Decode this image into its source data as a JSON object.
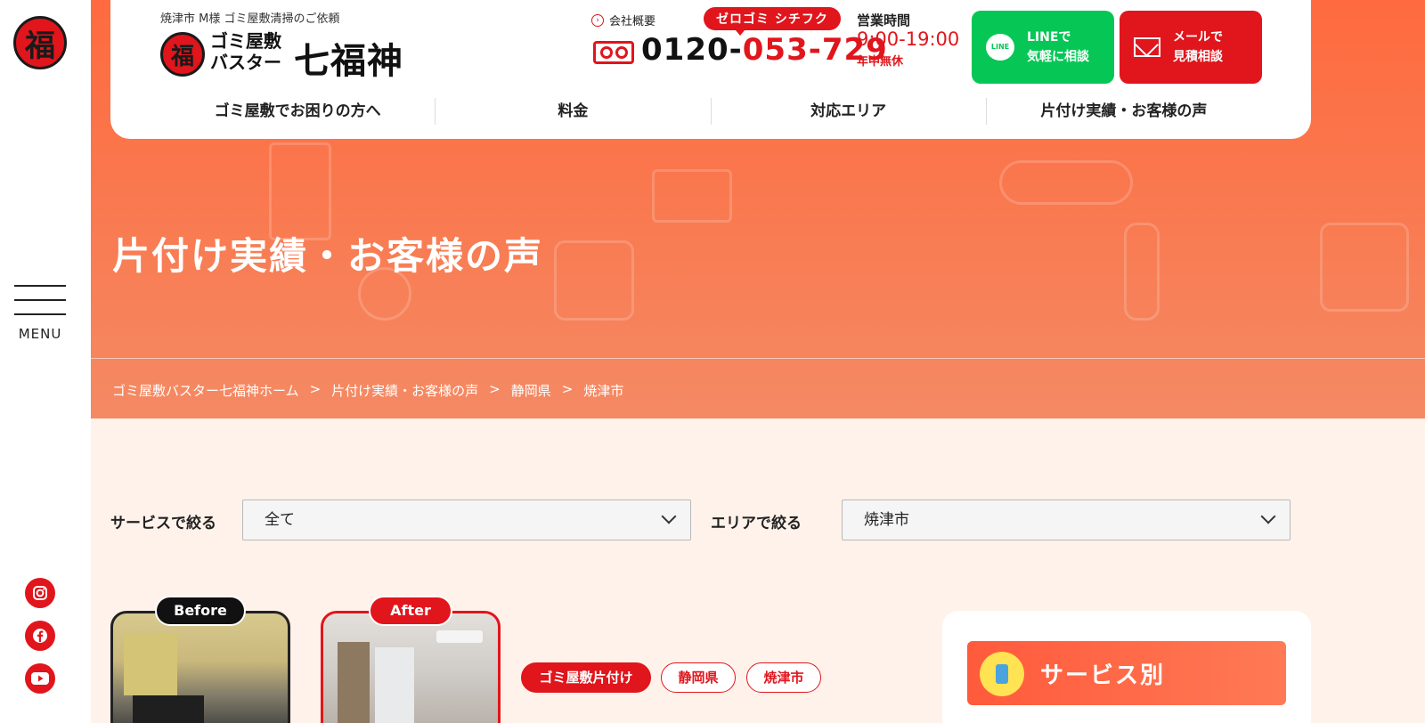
{
  "sidebar": {
    "logo_char": "福",
    "menu_label": "MENU",
    "social": [
      {
        "icon": "instagram-icon"
      },
      {
        "icon": "facebook-icon"
      },
      {
        "icon": "youtube-icon"
      }
    ]
  },
  "header": {
    "tagline": "焼津市 M様 ゴミ屋敷清掃のご依頼",
    "logo_char": "福",
    "brand_sub": "ゴミ屋敷バスター",
    "brand_name": "七福神",
    "company_link": "会社概要",
    "catch_badge": "ゼロゴミ シチフク",
    "phone_prefix": "0120-",
    "phone_number": "053-729",
    "hours_label": "営業時間",
    "hours": "9:00-19:00",
    "hours_note": "年中無休",
    "cta_line": {
      "line1": "LINEで",
      "line2": "気軽に相談",
      "icon_text": "LINE"
    },
    "cta_mail": {
      "line1": "メールで",
      "line2": "見積相談"
    },
    "nav": [
      "ゴミ屋敷でお困りの方へ",
      "料金",
      "対応エリア",
      "片付け実績・お客様の声"
    ]
  },
  "hero": {
    "title": "片付け実績・お客様の声",
    "breadcrumb": [
      "ゴミ屋敷バスター七福神ホーム",
      ">",
      "片付け実績・お客様の声",
      ">",
      "静岡県",
      ">",
      "焼津市"
    ]
  },
  "filters": {
    "service_label": "サービスで絞る",
    "service_value": "全て",
    "area_label": "エリアで絞る",
    "area_value": "焼津市"
  },
  "case": {
    "before_label": "Before",
    "after_label": "After",
    "tags": [
      "ゴミ屋敷片付け",
      "静岡県",
      "焼津市"
    ]
  },
  "side_panel": {
    "title": "サービス別"
  },
  "colors": {
    "brand_red": "#e1151c",
    "line_green": "#06c755",
    "hero_orange": "#ff6a3f",
    "page_bg": "#fff2ea"
  }
}
